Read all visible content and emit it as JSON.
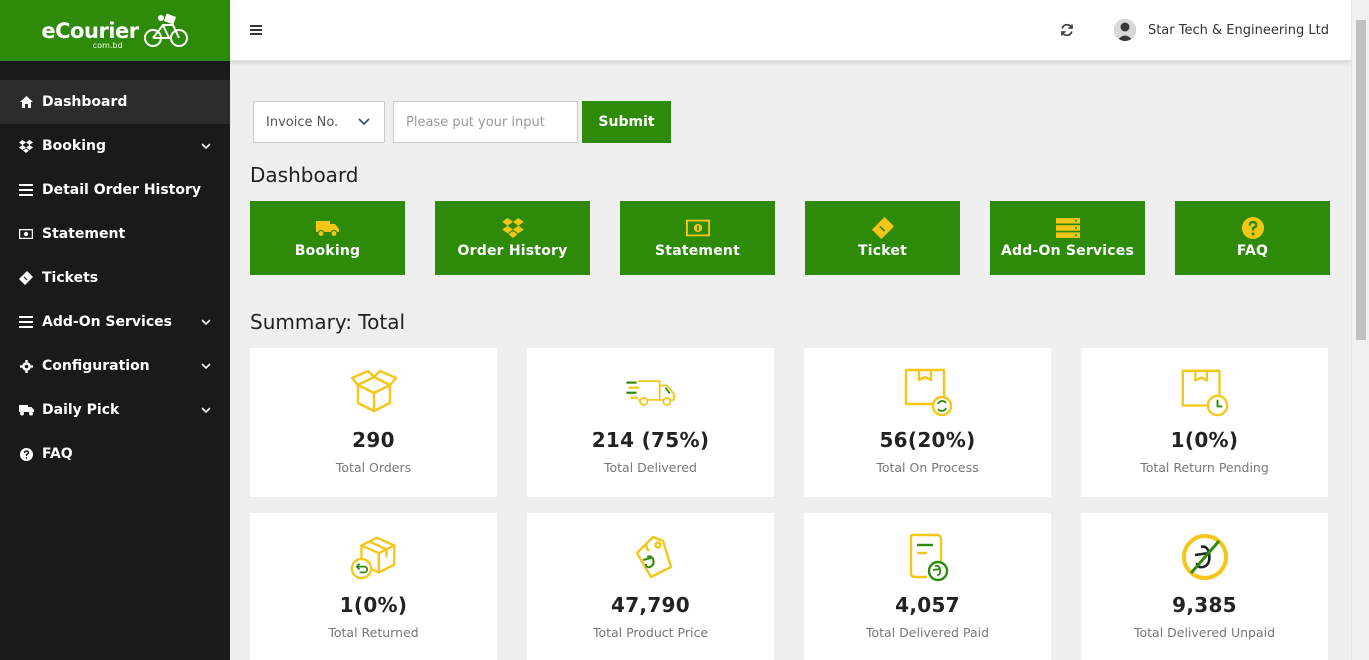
{
  "brand": {
    "name": "eCourier",
    "sub": "com.bd",
    "color": "#2e8b0a"
  },
  "sidebar": {
    "items": [
      {
        "label": "Dashboard",
        "icon": "home-icon",
        "active": true,
        "has_caret": false
      },
      {
        "label": "Booking",
        "icon": "dropbox-icon",
        "active": false,
        "has_caret": true
      },
      {
        "label": "Detail Order History",
        "icon": "list-icon",
        "active": false,
        "has_caret": false
      },
      {
        "label": "Statement",
        "icon": "money-icon",
        "active": false,
        "has_caret": false
      },
      {
        "label": "Tickets",
        "icon": "ticket-icon",
        "active": false,
        "has_caret": false
      },
      {
        "label": "Add-On Services",
        "icon": "menu-icon",
        "active": false,
        "has_caret": true
      },
      {
        "label": "Configuration",
        "icon": "gear-icon",
        "active": false,
        "has_caret": true
      },
      {
        "label": "Daily Pick",
        "icon": "truck-icon",
        "active": false,
        "has_caret": true
      },
      {
        "label": "FAQ",
        "icon": "question-icon",
        "active": false,
        "has_caret": false
      }
    ]
  },
  "topbar": {
    "company": "Star Tech & Engineering Ltd"
  },
  "search": {
    "select_value": "Invoice No.",
    "input_placeholder": "Please put your input",
    "submit_label": "Submit"
  },
  "dashboard": {
    "title": "Dashboard",
    "quick_links": [
      {
        "label": "Booking",
        "icon": "truck-icon"
      },
      {
        "label": "Order History",
        "icon": "dropbox-icon"
      },
      {
        "label": "Statement",
        "icon": "money-icon"
      },
      {
        "label": "Ticket",
        "icon": "ticket-icon"
      },
      {
        "label": "Add-On Services",
        "icon": "server-icon"
      },
      {
        "label": "FAQ",
        "icon": "question-icon"
      }
    ]
  },
  "summary": {
    "title": "Summary: Total",
    "cards": [
      {
        "value": "290",
        "label": "Total Orders",
        "icon": "open-box-icon"
      },
      {
        "value": "214 (75%)",
        "label": "Total Delivered",
        "icon": "delivery-truck-icon"
      },
      {
        "value": "56(20%)",
        "label": "Total On Process",
        "icon": "box-process-icon"
      },
      {
        "value": "1(0%)",
        "label": "Total Return Pending",
        "icon": "box-clock-icon"
      },
      {
        "value": "1(0%)",
        "label": "Total Returned",
        "icon": "box-return-icon"
      },
      {
        "value": "47,790",
        "label": "Total Product Price",
        "icon": "price-tag-icon"
      },
      {
        "value": "4,057",
        "label": "Total Delivered Paid",
        "icon": "invoice-paid-icon"
      },
      {
        "value": "9,385",
        "label": "Total Delivered Unpaid",
        "icon": "unpaid-icon"
      }
    ]
  }
}
